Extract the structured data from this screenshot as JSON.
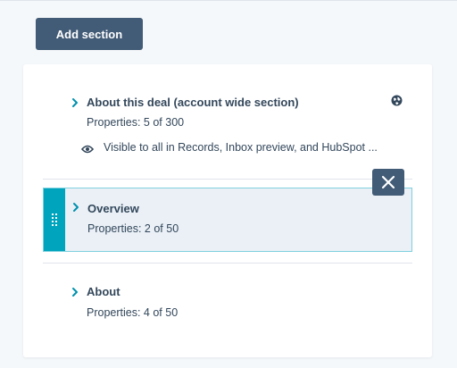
{
  "toolbar": {
    "add_section_label": "Add section"
  },
  "sections": [
    {
      "title": "About this deal (account wide section)",
      "properties": "Properties: 5 of 300",
      "visibility": "Visible to all in Records, Inbox preview, and HubSpot ...",
      "icon": "globe-icon"
    },
    {
      "title": "Overview",
      "properties": "Properties: 2 of 50",
      "selected": true
    },
    {
      "title": "About",
      "properties": "Properties: 4 of 50"
    }
  ],
  "colors": {
    "primary_button": "#425b76",
    "selection_accent": "#00a4bd",
    "selection_background": "#eaf0f6",
    "chevron": "#0091ae",
    "text": "#33475b"
  }
}
